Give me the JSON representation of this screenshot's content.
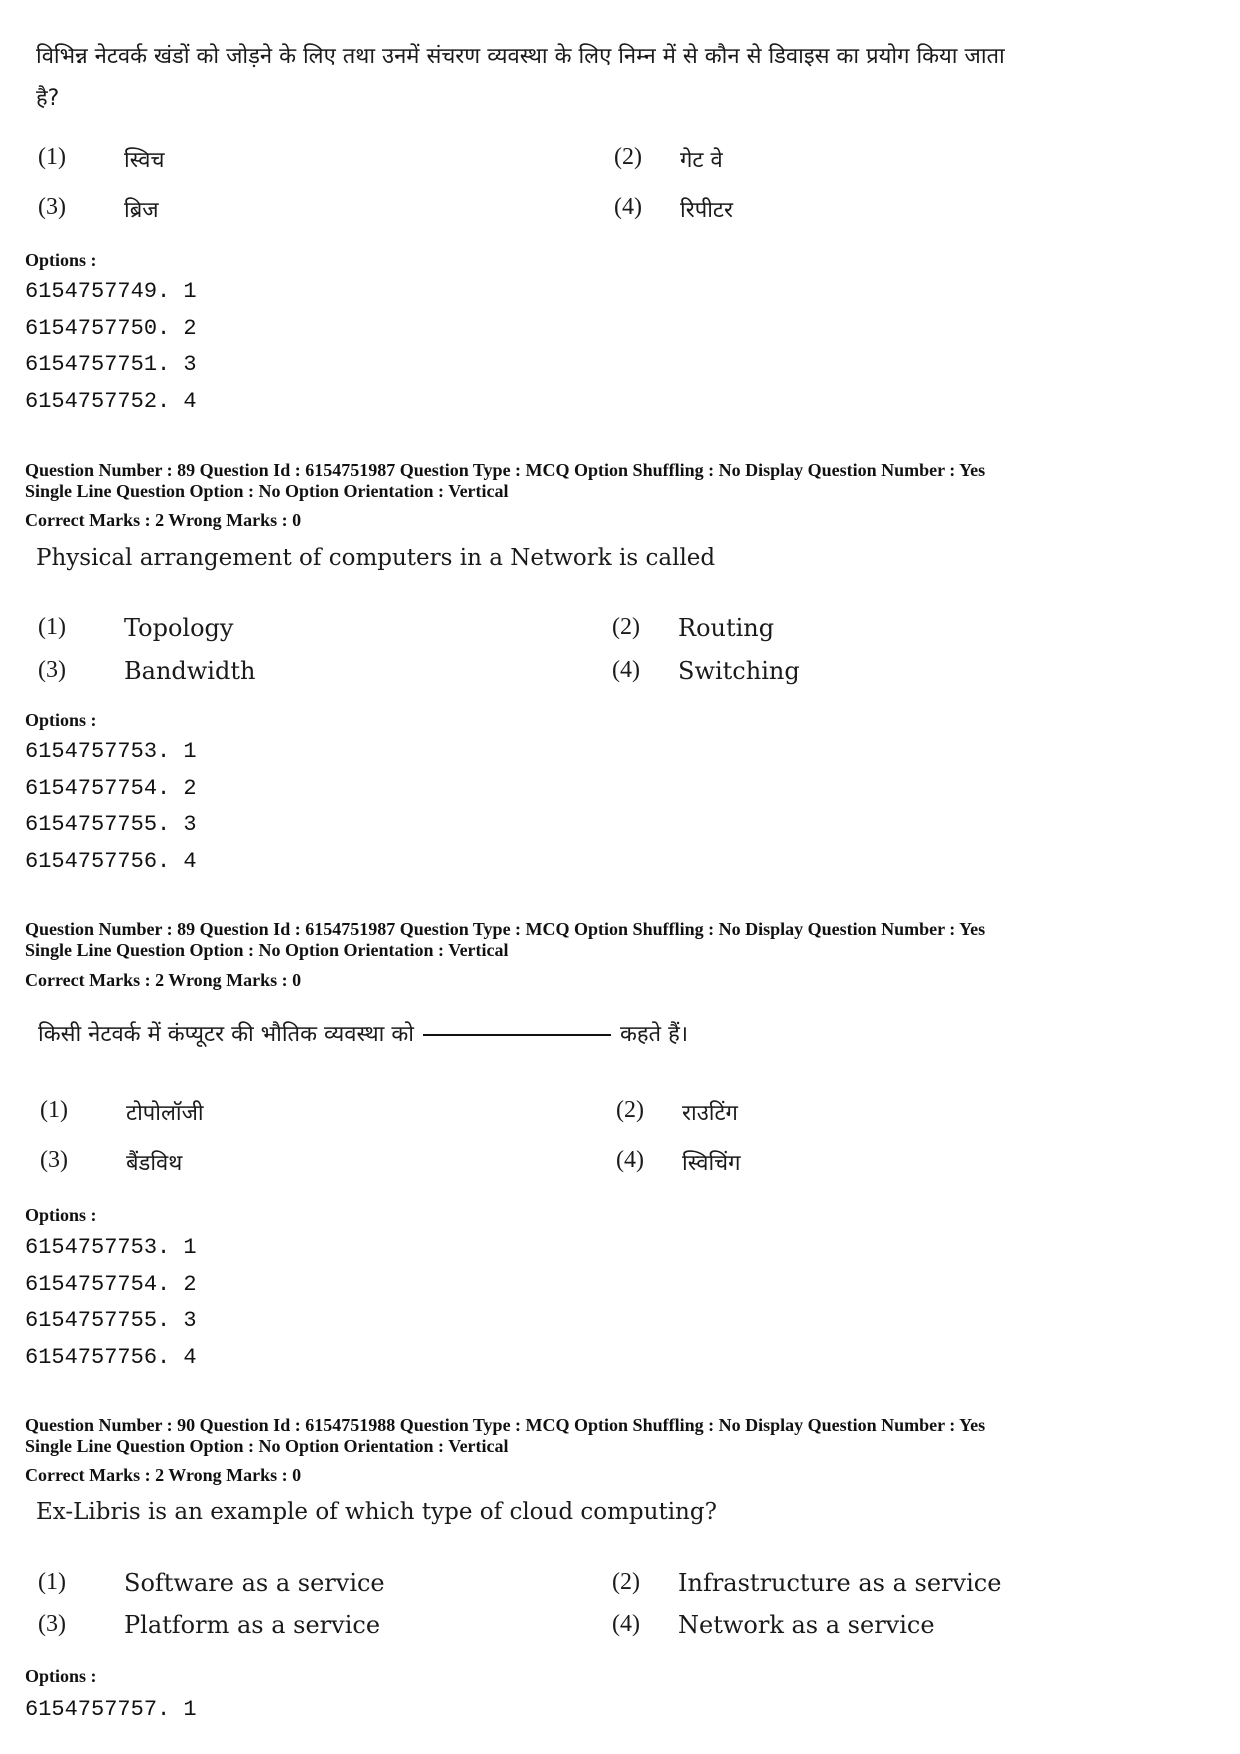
{
  "q88_hindi": {
    "text_line1": "विभिन्न नेटवर्क खंडों को जोड़ने के लिए तथा उनमें संचरण व्यवस्था के लिए निम्न में से कौन से डिवाइस का प्रयोग किया जाता",
    "text_line2": "है?",
    "options": [
      {
        "num": "(1)",
        "text": "स्विच"
      },
      {
        "num": "(2)",
        "text": "गेट वे"
      },
      {
        "num": "(3)",
        "text": "ब्रिज"
      },
      {
        "num": "(4)",
        "text": "रिपीटर"
      }
    ],
    "options_label": "Options :",
    "option_ids": [
      "6154757749. 1",
      "6154757750. 2",
      "6154757751. 3",
      "6154757752. 4"
    ]
  },
  "q89_english": {
    "meta_line1": "Question Number : 89  Question Id : 6154751987  Question Type : MCQ  Option Shuffling : No  Display Question Number : Yes",
    "meta_line2": "Single Line Question Option : No  Option Orientation : Vertical",
    "marks": "Correct Marks : 2  Wrong Marks : 0",
    "text": "Physical arrangement of computers in a Network is called",
    "options": [
      {
        "num": "(1)",
        "text": "Topology"
      },
      {
        "num": "(2)",
        "text": "Routing"
      },
      {
        "num": "(3)",
        "text": "Bandwidth"
      },
      {
        "num": "(4)",
        "text": "Switching"
      }
    ],
    "options_label": "Options :",
    "option_ids": [
      "6154757753. 1",
      "6154757754. 2",
      "6154757755. 3",
      "6154757756. 4"
    ]
  },
  "q89_hindi": {
    "meta_line1": "Question Number : 89  Question Id : 6154751987  Question Type : MCQ  Option Shuffling : No  Display Question Number : Yes",
    "meta_line2": "Single Line Question Option : No  Option Orientation : Vertical",
    "marks": "Correct Marks : 2  Wrong Marks : 0",
    "text_before": "किसी नेटवर्क में कंप्यूटर की भौतिक व्यवस्था को",
    "text_after": "कहते हैं।",
    "options": [
      {
        "num": "(1)",
        "text": "टोपोलॉजी"
      },
      {
        "num": "(2)",
        "text": "राउटिंग"
      },
      {
        "num": "(3)",
        "text": "बैंडविथ"
      },
      {
        "num": "(4)",
        "text": "स्विचिंग"
      }
    ],
    "options_label": "Options :",
    "option_ids": [
      "6154757753. 1",
      "6154757754. 2",
      "6154757755. 3",
      "6154757756. 4"
    ]
  },
  "q90_english": {
    "meta_line1": "Question Number : 90  Question Id : 6154751988  Question Type : MCQ  Option Shuffling : No  Display Question Number : Yes",
    "meta_line2": "Single Line Question Option : No  Option Orientation : Vertical",
    "marks": "Correct Marks : 2  Wrong Marks : 0",
    "text": "Ex-Libris is an example of which type of cloud computing?",
    "options": [
      {
        "num": "(1)",
        "text": "Software as a service"
      },
      {
        "num": "(2)",
        "text": "Infrastructure as a service"
      },
      {
        "num": "(3)",
        "text": "Platform as a service"
      },
      {
        "num": "(4)",
        "text": "Network as a service"
      }
    ],
    "options_label": "Options :",
    "option_ids": [
      "6154757757. 1"
    ]
  }
}
